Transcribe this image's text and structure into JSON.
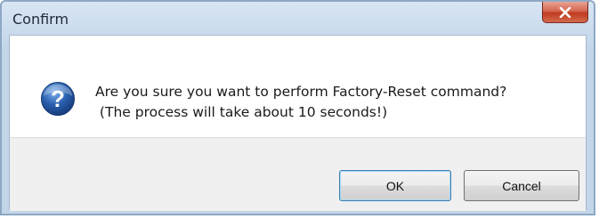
{
  "window": {
    "title": "Confirm",
    "close_icon": "close-icon"
  },
  "message": {
    "icon": "question-icon",
    "text": "Are you sure you want to perform Factory-Reset command?\n (The process will take about 10 seconds!)"
  },
  "buttons": {
    "ok_label": "OK",
    "cancel_label": "Cancel"
  },
  "colors": {
    "titlebar": "#c7d9ec",
    "close_button": "#c9452b",
    "question_icon": "#2a5fae",
    "default_button_border": "#3c7fb1"
  }
}
